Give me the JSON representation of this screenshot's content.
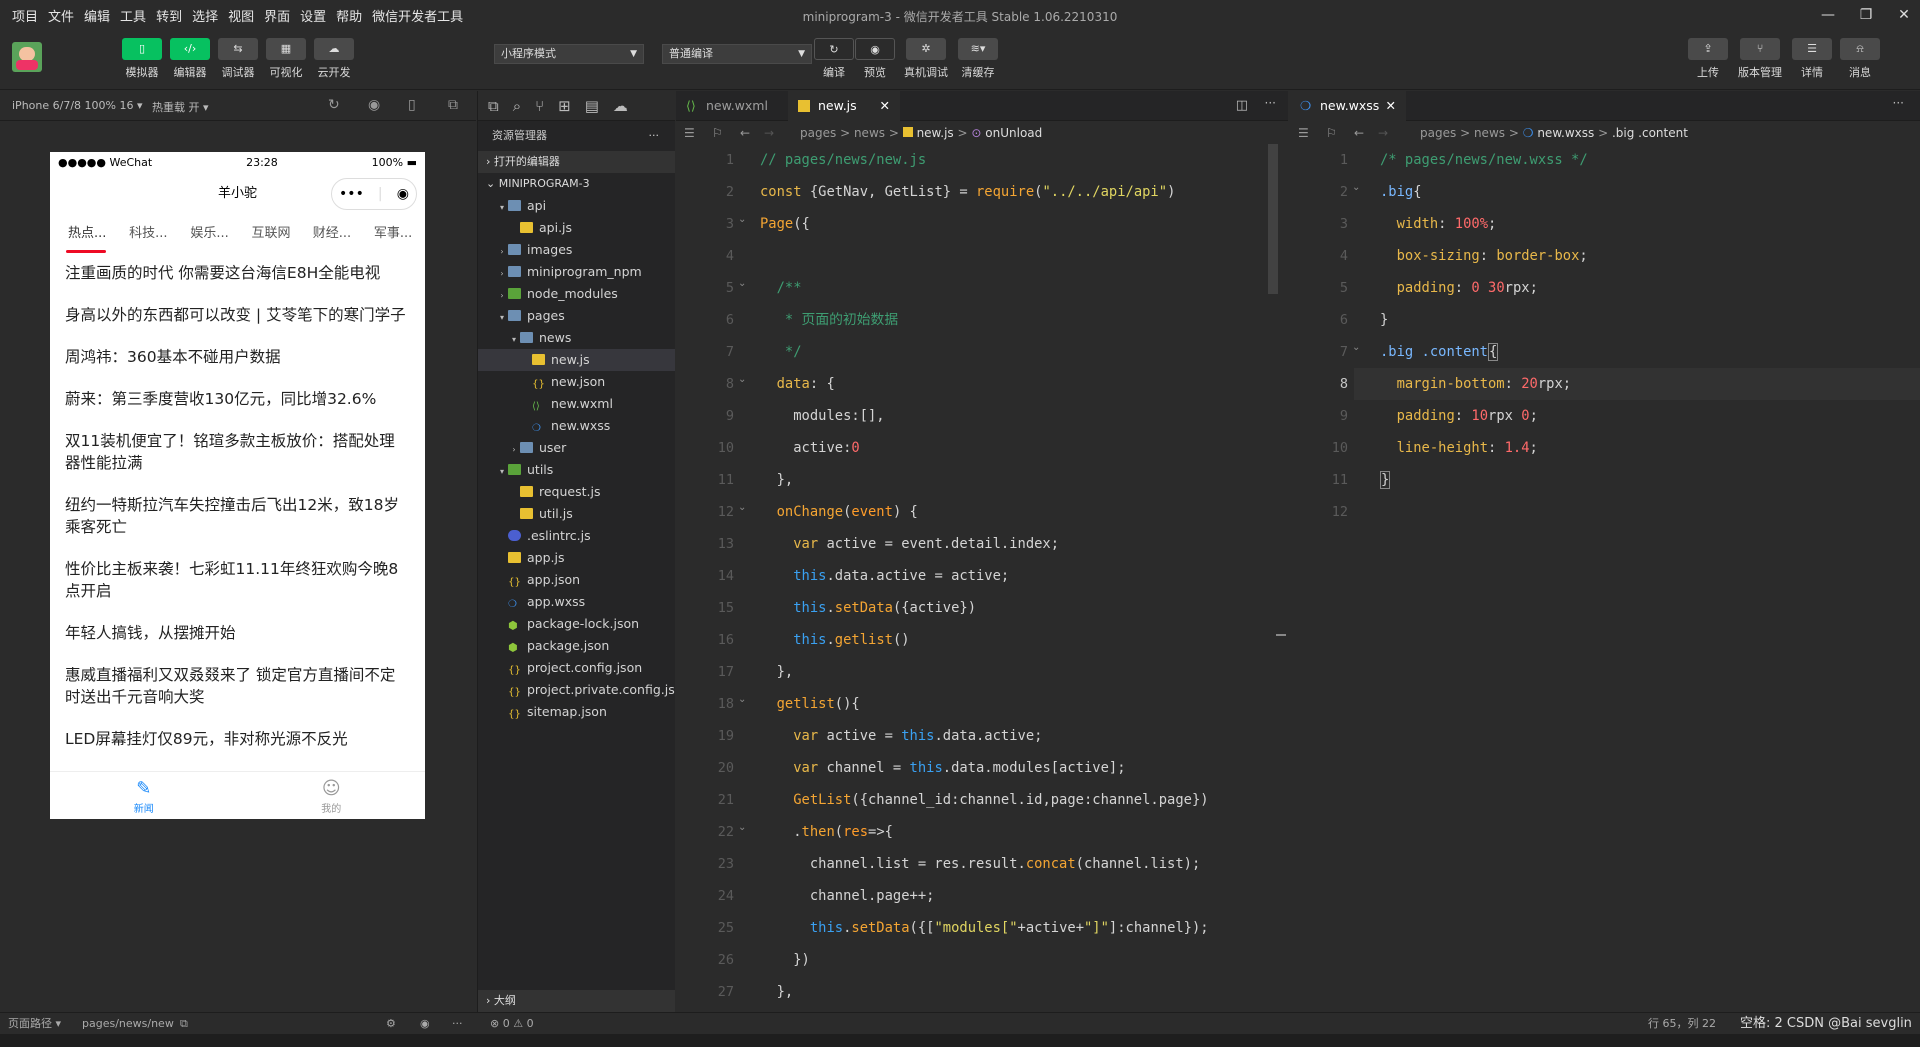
{
  "menubar": {
    "items": [
      "项目",
      "文件",
      "编辑",
      "工具",
      "转到",
      "选择",
      "视图",
      "界面",
      "设置",
      "帮助",
      "微信开发者工具"
    ],
    "window_title": "miniprogram-3 - 微信开发者工具 Stable 1.06.2210310"
  },
  "toolbar": {
    "left_buttons": [
      {
        "label": "模拟器",
        "icon": "phone-icon"
      },
      {
        "label": "编辑器",
        "icon": "code-icon"
      },
      {
        "label": "调试器",
        "icon": "debug-icon"
      },
      {
        "label": "可视化",
        "icon": "layout-icon"
      },
      {
        "label": "云开发",
        "icon": "cloud-icon"
      }
    ],
    "mode_select": "小程序模式",
    "compile_select": "普通编译",
    "mid_buttons": [
      {
        "label": "编译",
        "icon": "refresh-icon"
      },
      {
        "label": "预览",
        "icon": "eye-icon"
      },
      {
        "label": "真机调试",
        "icon": "bug-icon"
      },
      {
        "label": "清缓存",
        "icon": "layers-icon"
      }
    ],
    "right_buttons": [
      {
        "label": "上传",
        "icon": "upload-icon"
      },
      {
        "label": "版本管理",
        "icon": "branch-icon"
      },
      {
        "label": "详情",
        "icon": "menu-icon"
      },
      {
        "label": "消息",
        "icon": "bell-icon"
      }
    ]
  },
  "simulator": {
    "device": "iPhone 6/7/8 100% 16",
    "hot_reload": "热重载 开",
    "status_carrier": "●●●●● WeChat",
    "status_time": "23:28",
    "status_battery": "100%",
    "nav_title": "羊小驼",
    "tabs": [
      "热点...",
      "科技...",
      "娱乐...",
      "互联网",
      "财经...",
      "军事..."
    ],
    "news": [
      "注重画质的时代 你需要这台海信E8H全能电视",
      "身高以外的东西都可以改变 | 艾苓笔下的寒门学子",
      "周鸿祎：360基本不碰用户数据",
      "蔚来：第三季度营收130亿元，同比增32.6%",
      "双11装机便宜了！铭瑄多款主板放价：搭配处理器性能拉满",
      "纽约一特斯拉汽车失控撞击后飞出12米，致18岁乘客死亡",
      "性价比主板来袭！七彩虹11.11年终狂欢购今晚8点开启",
      "年轻人搞钱，从摆摊开始",
      "惠威直播福利又双叒叕来了 锁定官方直播间不定时送出千元音响大奖",
      "LED屏幕挂灯仅89元，非对称光源不反光"
    ],
    "tabbar": [
      {
        "label": "新闻",
        "active": true
      },
      {
        "label": "我的",
        "active": false
      }
    ]
  },
  "explorer": {
    "title": "资源管理器",
    "open_editors": "打开的编辑器",
    "project": "MINIPROGRAM-3",
    "tree": [
      {
        "name": "api",
        "type": "folder",
        "depth": 1,
        "open": true
      },
      {
        "name": "api.js",
        "type": "js",
        "depth": 2
      },
      {
        "name": "images",
        "type": "folder",
        "depth": 1,
        "open": false
      },
      {
        "name": "miniprogram_npm",
        "type": "folder",
        "depth": 1,
        "open": false
      },
      {
        "name": "node_modules",
        "type": "green",
        "depth": 1,
        "open": false
      },
      {
        "name": "pages",
        "type": "folder",
        "depth": 1,
        "open": true
      },
      {
        "name": "news",
        "type": "folder",
        "depth": 2,
        "open": true
      },
      {
        "name": "new.js",
        "type": "js",
        "depth": 3,
        "selected": true
      },
      {
        "name": "new.json",
        "type": "json",
        "depth": 3
      },
      {
        "name": "new.wxml",
        "type": "wxml",
        "depth": 3
      },
      {
        "name": "new.wxss",
        "type": "wxss",
        "depth": 3
      },
      {
        "name": "user",
        "type": "folder",
        "depth": 2,
        "open": false
      },
      {
        "name": "utils",
        "type": "green",
        "depth": 1,
        "open": true
      },
      {
        "name": "request.js",
        "type": "js",
        "depth": 2
      },
      {
        "name": "util.js",
        "type": "js",
        "depth": 2
      },
      {
        "name": ".eslintrc.js",
        "type": "blue",
        "depth": 1
      },
      {
        "name": "app.js",
        "type": "js",
        "depth": 1
      },
      {
        "name": "app.json",
        "type": "json",
        "depth": 1
      },
      {
        "name": "app.wxss",
        "type": "wxss",
        "depth": 1
      },
      {
        "name": "package-lock.json",
        "type": "pkg",
        "depth": 1
      },
      {
        "name": "package.json",
        "type": "pkg",
        "depth": 1
      },
      {
        "name": "project.config.json",
        "type": "json",
        "depth": 1
      },
      {
        "name": "project.private.config.js...",
        "type": "json",
        "depth": 1
      },
      {
        "name": "sitemap.json",
        "type": "json",
        "depth": 1
      }
    ],
    "outline": "大纲"
  },
  "editor1": {
    "tabs": [
      {
        "label": "new.wxml",
        "active": false
      },
      {
        "label": "new.js",
        "active": true
      }
    ],
    "breadcrumb": [
      "pages",
      ">",
      "news",
      ">",
      "new.js",
      ">",
      "onUnload"
    ],
    "line_numbers": [
      "1",
      "2",
      "3",
      "4",
      "5",
      "6",
      "7",
      "8",
      "9",
      "10",
      "11",
      "12",
      "13",
      "14",
      "15",
      "16",
      "17",
      "18",
      "19",
      "20",
      "21",
      "22",
      "23",
      "24",
      "25",
      "26",
      "27"
    ]
  },
  "editor2": {
    "tabs": [
      {
        "label": "new.wxss",
        "active": true
      }
    ],
    "breadcrumb": [
      "pages",
      ">",
      "news",
      ">",
      "new.wxss",
      ">",
      ".big .content"
    ],
    "line_numbers": [
      "1",
      "2",
      "3",
      "4",
      "5",
      "6",
      "7",
      "8",
      "9",
      "10",
      "11",
      "12"
    ]
  },
  "statusbar": {
    "left": "页面路径 ▾",
    "path": "pages/news/new",
    "errors": "⊗ 0 ⚠ 0",
    "position": "行 65，列 22",
    "watermark": "空格: 2 CSDN @Bai sevglin"
  }
}
